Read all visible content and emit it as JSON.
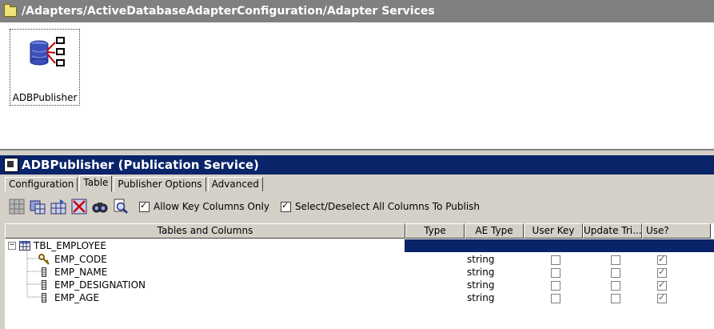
{
  "path_bar": {
    "title": "/Adapters/ActiveDatabaseAdapterConfiguration/Adapter Services"
  },
  "service_item": {
    "label": "ADBPublisher"
  },
  "panel": {
    "title": "ADBPublisher (Publication Service)"
  },
  "tabs": [
    {
      "label": "Configuration",
      "active": false
    },
    {
      "label": "Table",
      "active": true
    },
    {
      "label": "Publisher Options",
      "active": false
    },
    {
      "label": "Advanced",
      "active": false
    }
  ],
  "toolbar": {
    "allow_key_label": "Allow Key Columns Only",
    "allow_key_checked": true,
    "select_all_label": "Select/Deselect All Columns To Publish",
    "select_all_checked": true
  },
  "grid": {
    "columns": [
      "Tables and Columns",
      "Type",
      "AE Type",
      "User Key",
      "Update Tri...",
      "Use?"
    ],
    "table_name": "TBL_EMPLOYEE",
    "rows": [
      {
        "name": "EMP_CODE",
        "type": "",
        "ae_type": "string",
        "user_key": false,
        "update_trigger": false,
        "use": true,
        "key": true
      },
      {
        "name": "EMP_NAME",
        "type": "",
        "ae_type": "string",
        "user_key": false,
        "update_trigger": false,
        "use": true,
        "key": false
      },
      {
        "name": "EMP_DESIGNATION",
        "type": "",
        "ae_type": "string",
        "user_key": false,
        "update_trigger": false,
        "use": true,
        "key": false
      },
      {
        "name": "EMP_AGE",
        "type": "",
        "ae_type": "string",
        "user_key": false,
        "update_trigger": false,
        "use": true,
        "key": false
      }
    ]
  },
  "colors": {
    "path_bar": "#808080",
    "panel_title": "#0a246a",
    "selection": "#0a246a"
  }
}
